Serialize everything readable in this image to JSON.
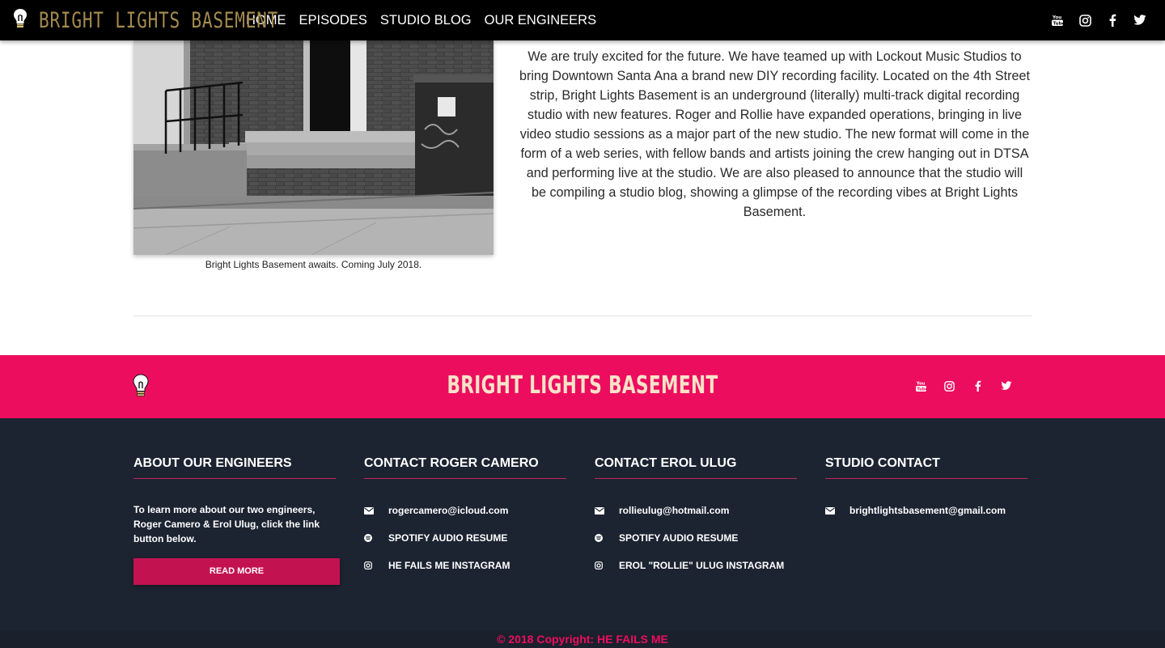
{
  "nav": {
    "brand": "BRIGHT LIGHTS BASEMENT",
    "links": [
      "HOME",
      "EPISODES",
      "STUDIO BLOG",
      "OUR ENGINEERS"
    ],
    "social_icons": [
      "youtube-icon",
      "instagram-icon",
      "facebook-icon",
      "twitter-icon"
    ]
  },
  "main": {
    "image_caption": "Bright Lights Basement awaits. Coming July 2018.",
    "article": "We are truly excited for the future. We have teamed up with Lockout Music Studios to bring Downtown Santa Ana a brand new DIY recording facility. Located on the 4th Street strip, Bright Lights Basement is an underground (literally) multi-track digital recording studio with new features. Roger and Rollie have expanded operations, bringing in live video studio sessions as a major part of the new studio. The new format will come in the form of a web series, with fellow bands and artists joining the crew hanging out in DTSA and performing live at the studio. We are also pleased to announce that the studio will be compiling a studio blog, showing a glimpse of the recording vibes at Bright Lights Basement."
  },
  "footer": {
    "title": "BRIGHT LIGHTS BASEMENT",
    "colors": {
      "band": "#ec0d5f",
      "dark": "#1c2331",
      "accent": "#c2124f"
    },
    "about": {
      "heading": "ABOUT OUR ENGINEERS",
      "text": "To learn more about our two engineers, Roger Camero & Erol Ulug, click the link button below.",
      "button": "READ MORE"
    },
    "roger": {
      "heading": "CONTACT ROGER CAMERO",
      "email": "rogercamero@icloud.com",
      "spotify": "SPOTIFY AUDIO RESUME",
      "instagram": "HE FAILS ME INSTAGRAM"
    },
    "erol": {
      "heading": "CONTACT EROL ULUG",
      "email": "rollieulug@hotmail.com",
      "spotify": "SPOTIFY AUDIO RESUME",
      "instagram": "EROL \"ROLLIE\" ULUG INSTAGRAM"
    },
    "studio": {
      "heading": "STUDIO CONTACT",
      "email": "brightlightsbasement@gmail.com"
    },
    "copyright": "© 2018 Copyright: HE FAILS ME"
  }
}
